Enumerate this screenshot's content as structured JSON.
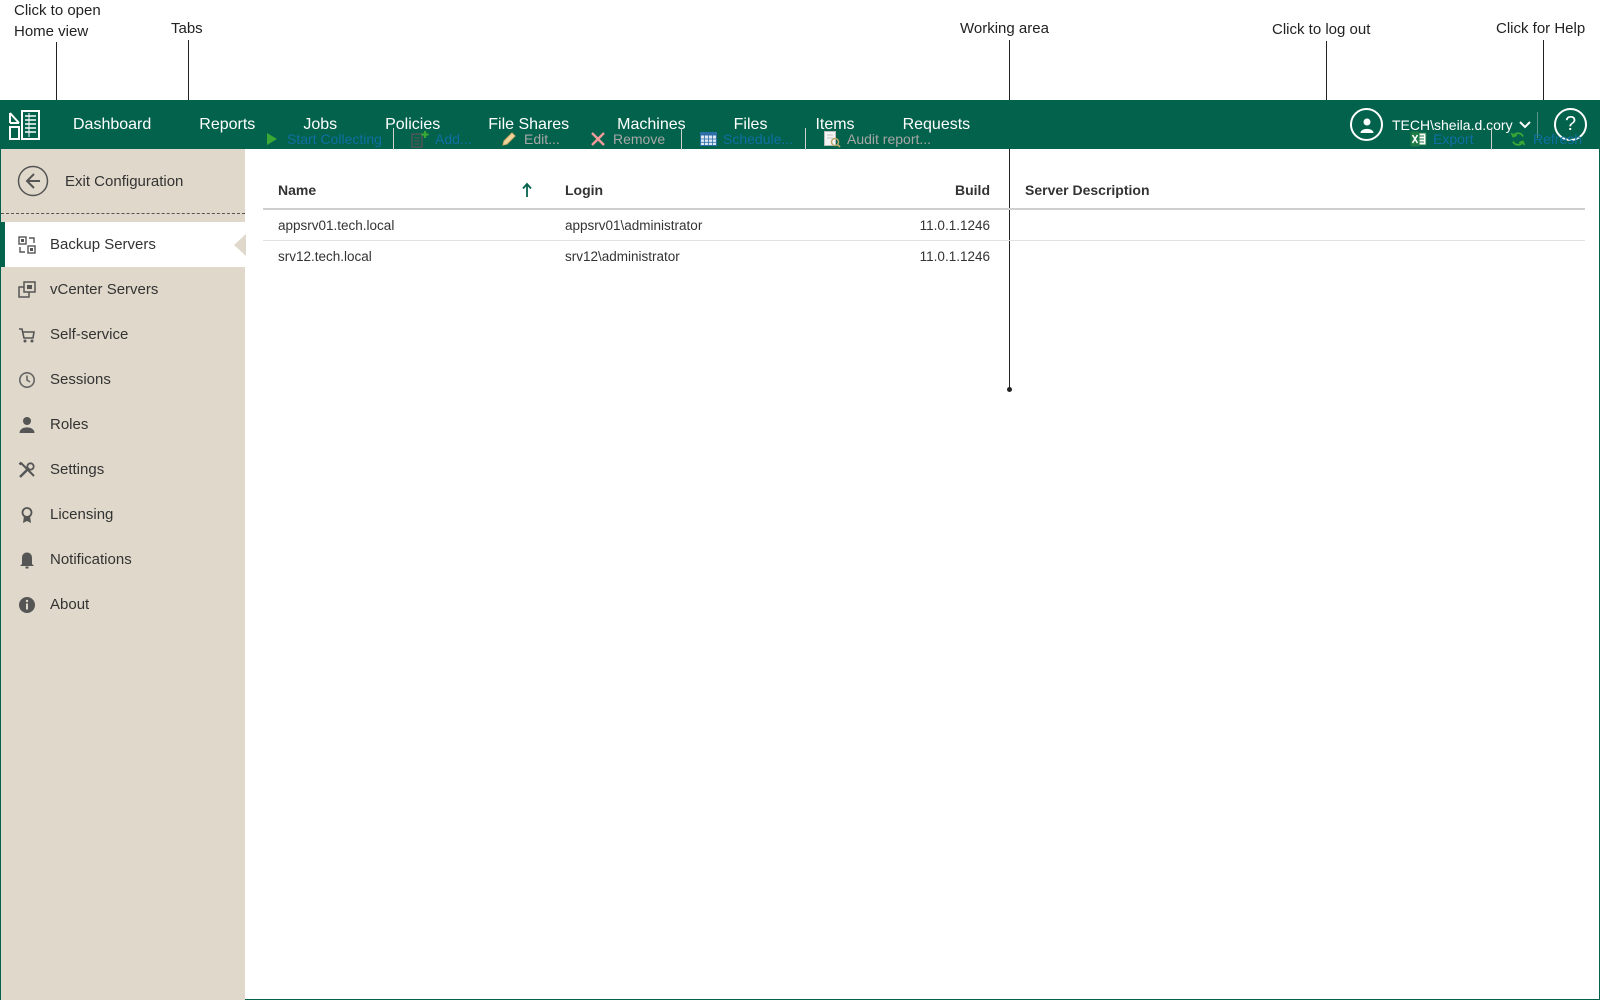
{
  "annotations": {
    "home_view": [
      "Click to open",
      "Home view"
    ],
    "tabs": "Tabs",
    "working_area": "Working area",
    "log_out": "Click to log out",
    "help": "Click for Help"
  },
  "topnav": {
    "items": [
      "Dashboard",
      "Reports",
      "Jobs",
      "Policies",
      "File Shares",
      "Machines",
      "Files",
      "Items",
      "Requests"
    ],
    "user": "TECH\\sheila.d.cory",
    "help_label": "?"
  },
  "sidebar": {
    "exit_label": "Exit Configuration",
    "items": [
      {
        "label": "Backup Servers",
        "icon": "backup-servers-icon",
        "active": true
      },
      {
        "label": "vCenter Servers",
        "icon": "vcenter-icon",
        "active": false
      },
      {
        "label": "Self-service",
        "icon": "cart-icon",
        "active": false
      },
      {
        "label": "Sessions",
        "icon": "clock-icon",
        "active": false
      },
      {
        "label": "Roles",
        "icon": "person-icon",
        "active": false
      },
      {
        "label": "Settings",
        "icon": "tools-icon",
        "active": false
      },
      {
        "label": "Licensing",
        "icon": "license-icon",
        "active": false
      },
      {
        "label": "Notifications",
        "icon": "bell-icon",
        "active": false
      },
      {
        "label": "About",
        "icon": "info-icon",
        "active": false
      }
    ]
  },
  "toolbar": {
    "start_collecting": "Start Collecting",
    "add": "Add...",
    "edit": "Edit...",
    "remove": "Remove",
    "schedule": "Schedule...",
    "audit_report": "Audit report...",
    "export": "Export",
    "refresh": "Refresh"
  },
  "table": {
    "columns": {
      "name": "Name",
      "login": "Login",
      "build": "Build",
      "description": "Server Description"
    },
    "rows": [
      {
        "name": "appsrv01.tech.local",
        "login": "appsrv01\\administrator",
        "build": "11.0.1.1246",
        "description": ""
      },
      {
        "name": "srv12.tech.local",
        "login": "srv12\\administrator",
        "build": "11.0.1.1246",
        "description": ""
      }
    ]
  },
  "colors": {
    "brand": "#03624c",
    "sidebar": "#e0d9cb",
    "link": "#0f6fa3"
  }
}
